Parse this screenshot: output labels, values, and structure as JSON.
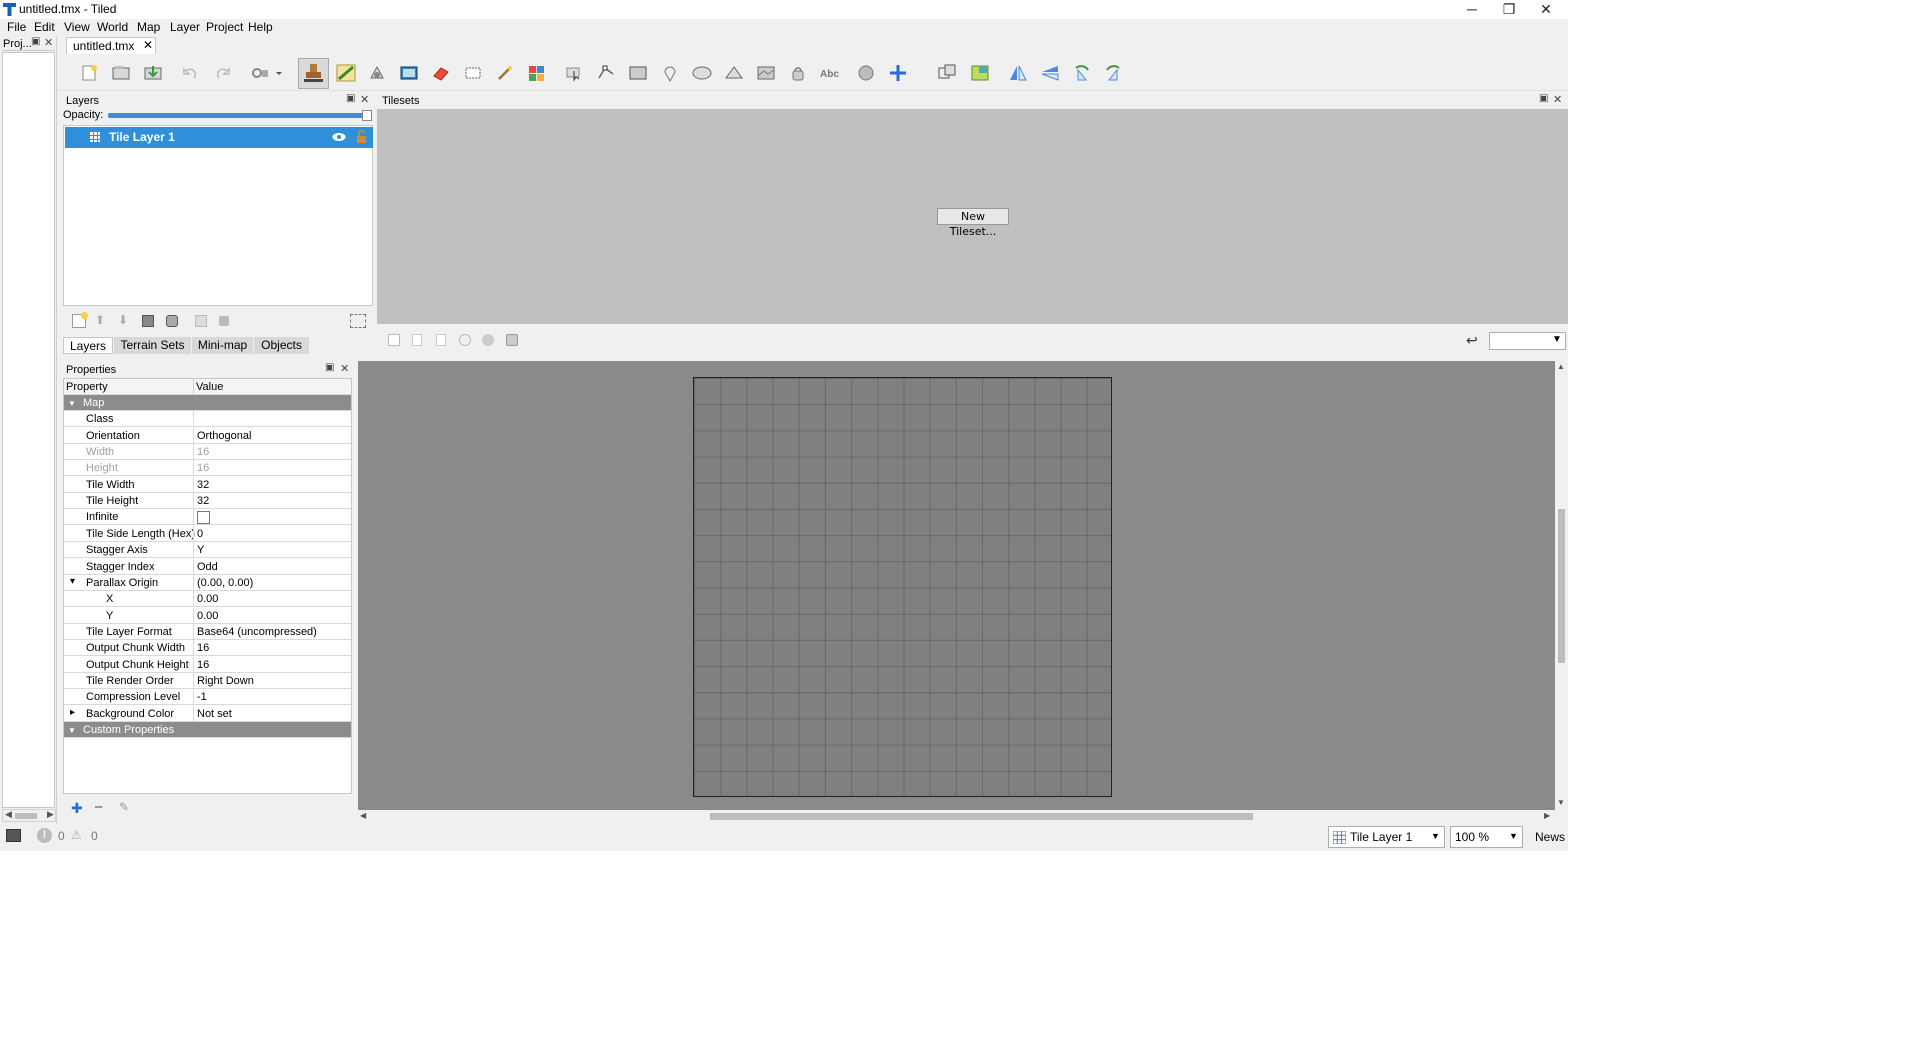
{
  "window": {
    "title": "untitled.tmx - Tiled",
    "minimize_glyph": "─",
    "restore_glyph": "❐",
    "close_glyph": "✕"
  },
  "menu": [
    "File",
    "Edit",
    "View",
    "World",
    "Map",
    "Layer",
    "Project",
    "Help"
  ],
  "project_dock": {
    "title": "Proj..."
  },
  "document_tab": {
    "label": "untitled.tmx"
  },
  "toolbar": {
    "icons": [
      "new-map",
      "open",
      "save",
      "undo",
      "redo",
      "command-button",
      "command-dropdown",
      "stamp-brush",
      "terrain-brush",
      "wang-brush",
      "bucket-fill",
      "shape-fill",
      "eraser",
      "rectangular-select",
      "magic-wand",
      "select-same-tile",
      "select-objects",
      "edit-polygons",
      "insert-rectangle",
      "insert-point",
      "insert-ellipse",
      "insert-polygon",
      "insert-tile",
      "insert-template",
      "insert-text",
      "layer-offset",
      "world-tool",
      "random-mode",
      "wang-fill-mode",
      "flip-horizontal",
      "flip-vertical",
      "rotate-left",
      "rotate-right"
    ]
  },
  "layers_dock": {
    "title": "Layers",
    "opacity_label": "Opacity:",
    "layers": [
      {
        "name": "Tile Layer 1",
        "visible": true,
        "locked": false
      }
    ]
  },
  "left_tabs": [
    "Layers",
    "Terrain Sets",
    "Mini-map",
    "Objects"
  ],
  "tilesets_dock": {
    "title": "Tilesets",
    "new_tileset_label": "New Tileset..."
  },
  "properties_dock": {
    "title": "Properties",
    "col_property": "Property",
    "col_value": "Value",
    "rows": [
      {
        "kind": "group",
        "name": "Map",
        "expander": "▼"
      },
      {
        "name": "Class",
        "value": ""
      },
      {
        "name": "Orientation",
        "value": "Orthogonal"
      },
      {
        "name": "Width",
        "value": "16",
        "disabled": true
      },
      {
        "name": "Height",
        "value": "16",
        "disabled": true
      },
      {
        "name": "Tile Width",
        "value": "32"
      },
      {
        "name": "Tile Height",
        "value": "32"
      },
      {
        "name": "Infinite",
        "value": "",
        "checkbox": true,
        "checked": false
      },
      {
        "name": "Tile Side Length (Hex)",
        "value": "0"
      },
      {
        "name": "Stagger Axis",
        "value": "Y"
      },
      {
        "name": "Stagger Index",
        "value": "Odd"
      },
      {
        "name": "Parallax Origin",
        "value": "(0.00, 0.00)",
        "expander": "▾"
      },
      {
        "name": "X",
        "value": "0.00",
        "child": true
      },
      {
        "name": "Y",
        "value": "0.00",
        "child": true
      },
      {
        "name": "Tile Layer Format",
        "value": "Base64 (uncompressed)"
      },
      {
        "name": "Output Chunk Width",
        "value": "16"
      },
      {
        "name": "Output Chunk Height",
        "value": "16"
      },
      {
        "name": "Tile Render Order",
        "value": "Right Down"
      },
      {
        "name": "Compression Level",
        "value": "-1"
      },
      {
        "name": "Background Color",
        "value": "Not set",
        "expander": "▸"
      },
      {
        "kind": "group",
        "name": "Custom Properties",
        "expander": "▼"
      }
    ]
  },
  "status": {
    "errors": "0",
    "warnings": "0",
    "current_layer": "Tile Layer 1",
    "zoom": "100 %",
    "news": "News"
  },
  "colors": {
    "selection": "#2f8fd8",
    "group_row": "#8c8c8c",
    "map_bg": "#808080",
    "view_bg": "#8a8a8a",
    "tileset_bg": "#c0c0c0"
  }
}
